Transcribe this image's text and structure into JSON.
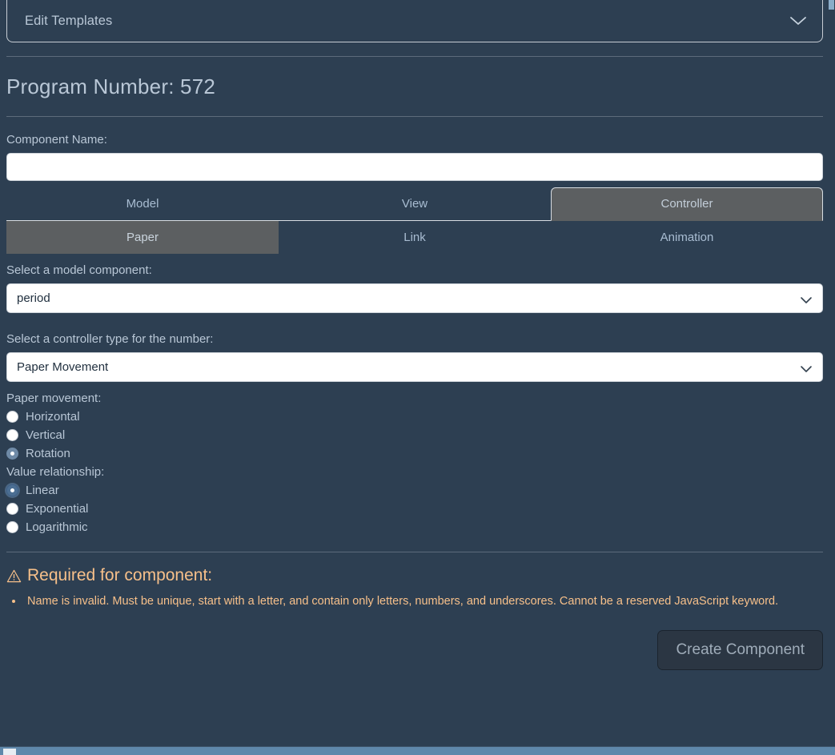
{
  "accordion": {
    "title": "Edit Templates",
    "chevron_icon": "chevron-down-icon"
  },
  "program": {
    "heading": "Program Number: 572"
  },
  "component_name": {
    "label": "Component Name:",
    "value": "",
    "placeholder": ""
  },
  "tabs_primary": [
    {
      "label": "Model",
      "active": false
    },
    {
      "label": "View",
      "active": false
    },
    {
      "label": "Controller",
      "active": true
    }
  ],
  "tabs_secondary": [
    {
      "label": "Paper",
      "active": true
    },
    {
      "label": "Link",
      "active": false
    },
    {
      "label": "Animation",
      "active": false
    }
  ],
  "model_component": {
    "label": "Select a model component:",
    "value": "period",
    "chevron_icon": "chevron-down-icon"
  },
  "controller_type": {
    "label": "Select a controller type for the number:",
    "value": "Paper Movement",
    "chevron_icon": "chevron-down-icon"
  },
  "paper_movement": {
    "label": "Paper movement:",
    "options": [
      {
        "label": "Horizontal",
        "checked": false,
        "focused": false
      },
      {
        "label": "Vertical",
        "checked": false,
        "focused": false
      },
      {
        "label": "Rotation",
        "checked": true,
        "focused": false
      }
    ]
  },
  "value_relationship": {
    "label": "Value relationship:",
    "options": [
      {
        "label": "Linear",
        "checked": true,
        "focused": true
      },
      {
        "label": "Exponential",
        "checked": false,
        "focused": false
      },
      {
        "label": "Logarithmic",
        "checked": false,
        "focused": false
      }
    ]
  },
  "warning": {
    "icon": "warning-triangle-icon",
    "title": "Required for component:",
    "items": [
      "Name is invalid. Must be unique, start with a letter, and contain only letters, numbers, and underscores. Cannot be a reserved JavaScript keyword."
    ]
  },
  "actions": {
    "create_label": "Create Component"
  },
  "colors": {
    "background": "#2d3f52",
    "text": "#b9c7d6",
    "tab_active": "#5c5f61",
    "warning": "#f7c08a",
    "button_bg": "#2b3643",
    "scrollbar": "#5f88ab"
  }
}
